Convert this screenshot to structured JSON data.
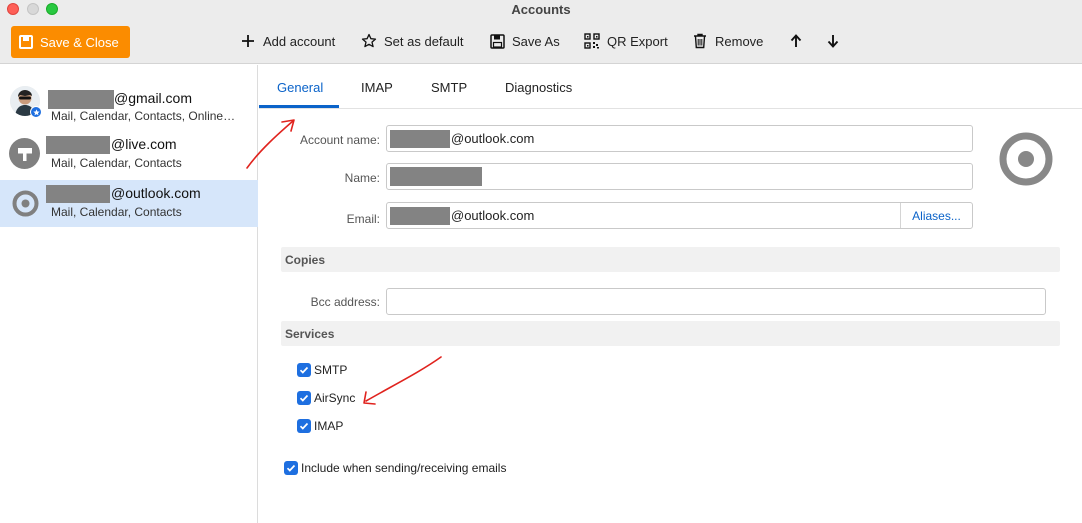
{
  "window": {
    "title": "Accounts"
  },
  "toolbar": {
    "save_close": "Save & Close",
    "add_account": "Add account",
    "set_default": "Set as default",
    "save_as": "Save As",
    "qr_export": "QR Export",
    "remove": "Remove"
  },
  "accounts": [
    {
      "email_suffix": "@gmail.com",
      "services": "Mail, Calendar, Contacts, Online…"
    },
    {
      "email_suffix": "@live.com",
      "services": "Mail, Calendar, Contacts"
    },
    {
      "email_suffix": "@outlook.com",
      "services": "Mail, Calendar, Contacts"
    }
  ],
  "tabs": [
    "General",
    "IMAP",
    "SMTP",
    "Diagnostics"
  ],
  "general": {
    "account_name_label": "Account name:",
    "account_name_suffix": "@outlook.com",
    "name_label": "Name:",
    "email_label": "Email:",
    "email_suffix": "@outlook.com",
    "aliases": "Aliases..."
  },
  "copies": {
    "title": "Copies",
    "bcc_label": "Bcc address:",
    "bcc_value": ""
  },
  "services": {
    "title": "Services",
    "items": [
      {
        "label": "SMTP",
        "checked": true
      },
      {
        "label": "AirSync",
        "checked": true
      },
      {
        "label": "IMAP",
        "checked": true
      }
    ],
    "include_label": "Include when sending/receiving emails"
  },
  "colors": {
    "accent": "#0b63c9",
    "save_button": "#fb8c00",
    "selected_row": "#d6e6fa",
    "annotation": "#e0231e"
  }
}
